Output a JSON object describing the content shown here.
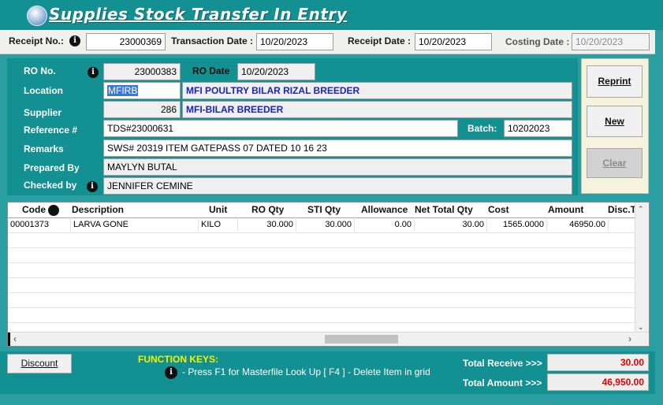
{
  "window": {
    "title": "Supplies Stock Transfer In Entry"
  },
  "header": {
    "receipt_no_label": "Receipt No.:",
    "receipt_no": "23000369",
    "transaction_date_label": "Transaction Date :",
    "transaction_date": "10/20/2023",
    "receipt_date_label": "Receipt Date :",
    "receipt_date": "10/20/2023",
    "costing_date_label": "Costing Date :",
    "costing_date": "10/20/2023"
  },
  "form": {
    "ro_no_label": "RO No.",
    "ro_no": "23000383",
    "ro_date_label": "RO Date",
    "ro_date": "10/20/2023",
    "location_label": "Location",
    "location_code": "MFIRB",
    "location_name": "MFI POULTRY BILAR RIZAL BREEDER",
    "supplier_label": "Supplier",
    "supplier_code": "286",
    "supplier_name": "MFI-BILAR BREEDER",
    "reference_label": "Reference #",
    "reference": "TDS#23000631",
    "batch_label": "Batch:",
    "batch": "10202023",
    "remarks_label": "Remarks",
    "remarks": "SWS# 20319 ITEM GATEPASS 07 DATED 10 16 23",
    "prepared_by_label": "Prepared By",
    "prepared_by": "MAYLYN BUTAL",
    "checked_by_label": "Checked by",
    "checked_by": "JENNIFER CEMINE"
  },
  "buttons": {
    "reprint": "Reprint",
    "new": "New",
    "clear": "Clear",
    "discount": "Discount"
  },
  "grid": {
    "columns": [
      "Code",
      "Description",
      "Unit",
      "RO Qty",
      "STI Qty",
      "Allowance",
      "Net Total Qty",
      "Cost",
      "Amount",
      "Disc.T"
    ],
    "rows": [
      {
        "code": "00001373",
        "description": "LARVA GONE",
        "unit": "KILO",
        "ro_qty": "30.000",
        "sti_qty": "30.000",
        "allowance": "0.00",
        "net_total_qty": "30.00",
        "cost": "1565.0000",
        "amount": "46950.00",
        "disc": ""
      }
    ]
  },
  "footer": {
    "function_keys_label": "FUNCTION KEYS:",
    "function_keys_text": "- Press F1 for Masterfile Look Up   [ F4 ] - Delete Item in grid",
    "total_receive_label": "Total Receive >>>",
    "total_receive": "30.00",
    "total_amount_label": "Total Amount >>>",
    "total_amount": "46,950.00"
  }
}
